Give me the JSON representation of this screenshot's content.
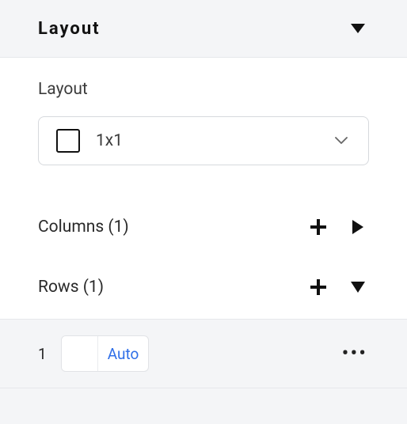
{
  "header": {
    "title": "Layout"
  },
  "body": {
    "section_label": "Layout",
    "layout_select": {
      "value": "1x1"
    },
    "columns": {
      "label": "Columns (1)"
    },
    "rows": {
      "label": "Rows (1)"
    }
  },
  "row_detail": {
    "index": "1",
    "size_label": "Auto"
  }
}
